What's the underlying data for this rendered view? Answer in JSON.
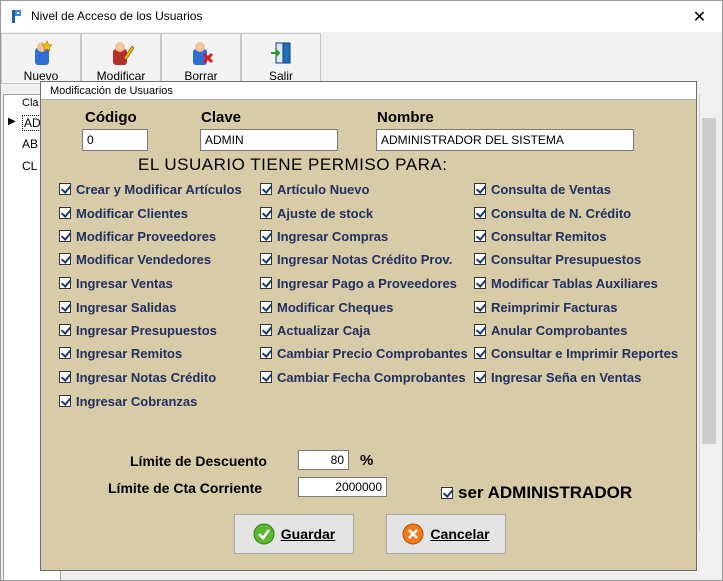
{
  "window": {
    "title": "Nivel de Acceso de los Usuarios",
    "close_glyph": "✕"
  },
  "toolbar": [
    {
      "label": "Nuevo",
      "icon": "new-star-icon"
    },
    {
      "label": "Modificar",
      "icon": "edit-pencil-icon"
    },
    {
      "label": "Borrar",
      "icon": "delete-x-icon"
    },
    {
      "label": "Salir",
      "icon": "exit-door-icon"
    }
  ],
  "grid": {
    "header": "Cla",
    "rows": [
      "AD",
      "AB",
      "CL"
    ]
  },
  "dialog": {
    "title": "Modificación de Usuarios",
    "codigo_label": "Código",
    "clave_label": "Clave",
    "nombre_label": "Nombre",
    "codigo_value": "0",
    "clave_value": "ADMIN",
    "nombre_value": "ADMINISTRADOR DEL SISTEMA",
    "permissions_heading": "EL USUARIO TIENE PERMISO PARA:",
    "permissions": {
      "col1": [
        "Crear y Modificar Artículos",
        "Modificar Clientes",
        "Modificar Proveedores",
        "Modificar Vendedores",
        "Ingresar Ventas",
        "Ingresar Salidas",
        "Ingresar Presupuestos",
        "Ingresar Remitos",
        "Ingresar Notas Crédito",
        "Ingresar Cobranzas"
      ],
      "col2": [
        "Artículo Nuevo",
        "Ajuste de stock",
        "Ingresar Compras",
        "Ingresar Notas Crédito Prov.",
        "Ingresar Pago a Proveedores",
        "Modificar Cheques",
        "Actualizar Caja",
        "Cambiar Precio Comprobantes",
        "Cambiar Fecha Comprobantes"
      ],
      "col3": [
        "Consulta de Ventas",
        "Consulta de N. Crédito",
        "Consultar Remitos",
        "Consultar Presupuestos",
        "Modificar Tablas Auxiliares",
        "Reimprimir Facturas",
        "Anular Comprobantes",
        "Consultar e Imprimir Reportes",
        "Ingresar Seña en Ventas"
      ]
    },
    "limite_descuento_label": "Límite de Descuento",
    "limite_descuento_value": "80",
    "percent_sign": "%",
    "limite_cta_label": "Límite de Cta Corriente",
    "limite_cta_value": "2000000",
    "admin_label": "ser ADMINISTRADOR",
    "guardar_label": "Guardar",
    "cancelar_label": "Cancelar"
  }
}
